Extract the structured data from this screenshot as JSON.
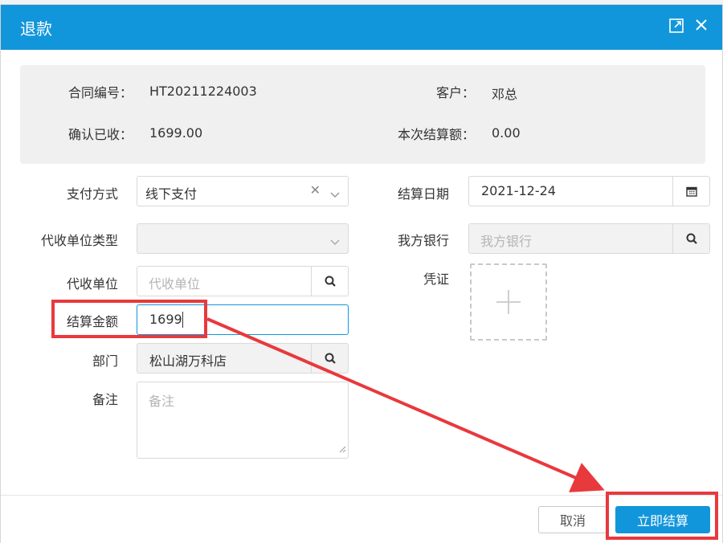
{
  "dialog": {
    "title": "退款"
  },
  "summary": {
    "contract_label": "合同编号：",
    "contract_value": "HT20211224003",
    "customer_label": "客户：",
    "customer_value": "邓总",
    "confirmed_label": "确认已收：",
    "confirmed_value": "1699.00",
    "settle_label": "本次结算额：",
    "settle_value": "0.00"
  },
  "form": {
    "payment_method": {
      "label": "支付方式",
      "value": "线下支付"
    },
    "collector_type": {
      "label": "代收单位类型",
      "value": ""
    },
    "collector": {
      "label": "代收单位",
      "placeholder": "代收单位"
    },
    "amount": {
      "label": "结算金额",
      "value": "1699"
    },
    "department": {
      "label": "部门",
      "value": "松山湖万科店"
    },
    "remark": {
      "label": "备注",
      "placeholder": "备注"
    },
    "settle_date": {
      "label": "结算日期",
      "value": "2021-12-24"
    },
    "our_bank": {
      "label": "我方银行",
      "placeholder": "我方银行"
    },
    "voucher": {
      "label": "凭证"
    }
  },
  "footer": {
    "cancel_label": "取消",
    "confirm_label": "立即结算"
  },
  "colors": {
    "accent": "#1296db",
    "annotation": "#e8393d"
  }
}
